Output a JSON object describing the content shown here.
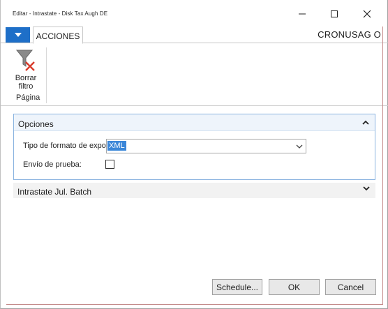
{
  "window": {
    "title": "Editar - Intrastate - Disk Tax Augh DE",
    "minimize_icon": "minimize-icon",
    "maximize_icon": "maximize-icon",
    "close_icon": "close-icon"
  },
  "ribbon": {
    "app_menu_icon": "chevron-down-icon",
    "tab_label": "ACCIONES",
    "company": "CRONUSAG O",
    "actions": [
      {
        "label_line1": "Borrar",
        "label_line2": "filtro",
        "icon": "clear-filter-icon"
      }
    ],
    "group_label": "Página"
  },
  "opciones": {
    "title": "Opciones",
    "collapse_icon": "chevron-up-icon",
    "format_label": "Tipo de formato de exportación:",
    "format_value": "XML",
    "test_label": "Envío de prueba:",
    "test_checked": false
  },
  "batch": {
    "title": "Intrastate Jul. Batch",
    "expand_icon": "chevron-down-icon"
  },
  "buttons": {
    "schedule": "Schedule...",
    "ok": "OK",
    "cancel": "Cancel"
  },
  "colors": {
    "accent_blue": "#1e6fc8",
    "section_border": "#8bb4e0",
    "selection": "#3a86d8",
    "window_accent": "#c48a8a"
  }
}
